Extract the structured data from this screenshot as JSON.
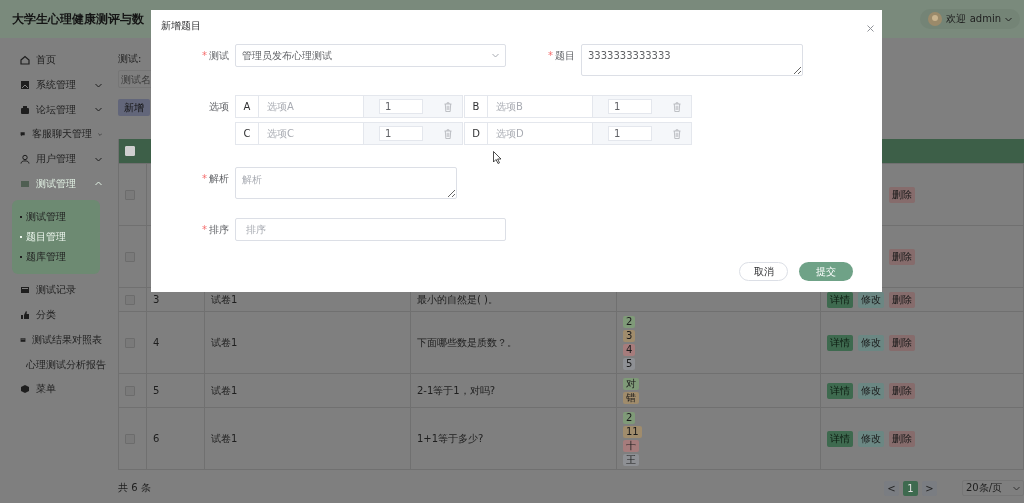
{
  "header": {
    "title": "大学生心理健康测评与数",
    "user": "欢迎 admin"
  },
  "sidebar": {
    "items": [
      {
        "label": "首页"
      },
      {
        "label": "系统管理",
        "expanded": false
      },
      {
        "label": "论坛管理",
        "expanded": false
      },
      {
        "label": "客服聊天管理",
        "expanded": false
      },
      {
        "label": "用户管理",
        "expanded": false
      },
      {
        "label": "测试管理",
        "expanded": true,
        "children": [
          {
            "label": "测试管理",
            "selected": false
          },
          {
            "label": "题目管理",
            "selected": true
          },
          {
            "label": "题库管理",
            "selected": false
          }
        ]
      },
      {
        "label": "测试记录"
      },
      {
        "label": "分类"
      },
      {
        "label": "测试结果对照表"
      },
      {
        "label": "心理测试分析报告"
      },
      {
        "label": "菜单"
      }
    ]
  },
  "search": {
    "label": "测试:",
    "placeholder": "测试名"
  },
  "add_button": "新增",
  "table": {
    "header": {
      "checked": false
    },
    "rows": [
      {
        "checked": false,
        "actions": [
          {
            "kind": "delete",
            "label": "删除"
          }
        ]
      },
      {
        "checked": false,
        "actions": [
          {
            "kind": "delete",
            "label": "删除"
          }
        ]
      },
      {
        "checked": false,
        "index": "3",
        "paper": "试卷1",
        "question": "最小的自然是( )。",
        "options": [],
        "actions": [
          {
            "kind": "details",
            "label": "详情"
          },
          {
            "kind": "edit",
            "label": "修改"
          },
          {
            "kind": "delete",
            "label": "删除"
          }
        ]
      },
      {
        "checked": false,
        "index": "4",
        "paper": "试卷1",
        "question": "下面哪些数是质数？。",
        "options": [
          {
            "label": "2",
            "color": "#7f9a78"
          },
          {
            "label": "3",
            "color": "#a08c6c"
          },
          {
            "label": "4",
            "color": "#a67c7c"
          },
          {
            "label": "5",
            "color": "#8e9094"
          }
        ],
        "actions": [
          {
            "kind": "details",
            "label": "详情"
          },
          {
            "kind": "edit",
            "label": "修改"
          },
          {
            "kind": "delete",
            "label": "删除"
          }
        ]
      },
      {
        "checked": false,
        "index": "5",
        "paper": "试卷1",
        "question": "2-1等于1，对吗?",
        "options": [
          {
            "label": "对",
            "color": "#7f9a78"
          },
          {
            "label": "错",
            "color": "#a08c6c"
          }
        ],
        "actions": [
          {
            "kind": "details",
            "label": "详情"
          },
          {
            "kind": "edit",
            "label": "修改"
          },
          {
            "kind": "delete",
            "label": "删除"
          }
        ]
      },
      {
        "checked": false,
        "index": "6",
        "paper": "试卷1",
        "question": "1+1等于多少?",
        "options": [
          {
            "label": "2",
            "color": "#7f9a78"
          },
          {
            "label": "11",
            "color": "#a08c6c"
          },
          {
            "label": "十",
            "color": "#a67c7c"
          },
          {
            "label": "王",
            "color": "#8e9094"
          }
        ],
        "actions": [
          {
            "kind": "details",
            "label": "详情"
          },
          {
            "kind": "edit",
            "label": "修改"
          },
          {
            "kind": "delete",
            "label": "删除"
          }
        ]
      }
    ]
  },
  "footer": {
    "total": "共 6 条",
    "prev": "<",
    "pages": [
      {
        "label": "1",
        "selected": true
      }
    ],
    "next": ">",
    "page_size": "20条/页"
  },
  "dialog": {
    "title": "新增题目",
    "fields": [
      {
        "kind": "select",
        "label": "测试",
        "required_mark": "*",
        "value": "管理员发布心理测试"
      },
      {
        "kind": "textarea",
        "label": "题目",
        "required_mark": "*",
        "value": "3333333333333"
      },
      {
        "kind": "options",
        "label": "选项",
        "options": [
          {
            "letter": "A",
            "placeholder": "选项A",
            "score": "1"
          },
          {
            "letter": "B",
            "placeholder": "选项B",
            "score": "1"
          },
          {
            "letter": "C",
            "placeholder": "选项C",
            "score": "1"
          },
          {
            "letter": "D",
            "placeholder": "选项D",
            "score": "1"
          }
        ]
      },
      {
        "kind": "textarea",
        "label": "解析",
        "required_mark": "*",
        "placeholder": "解析"
      },
      {
        "kind": "input",
        "label": "排序",
        "required_mark": "*",
        "placeholder": "排序"
      }
    ],
    "buttons": [
      {
        "kind": "secondary",
        "label": "取消"
      },
      {
        "kind": "primary",
        "label": "提交"
      }
    ]
  }
}
